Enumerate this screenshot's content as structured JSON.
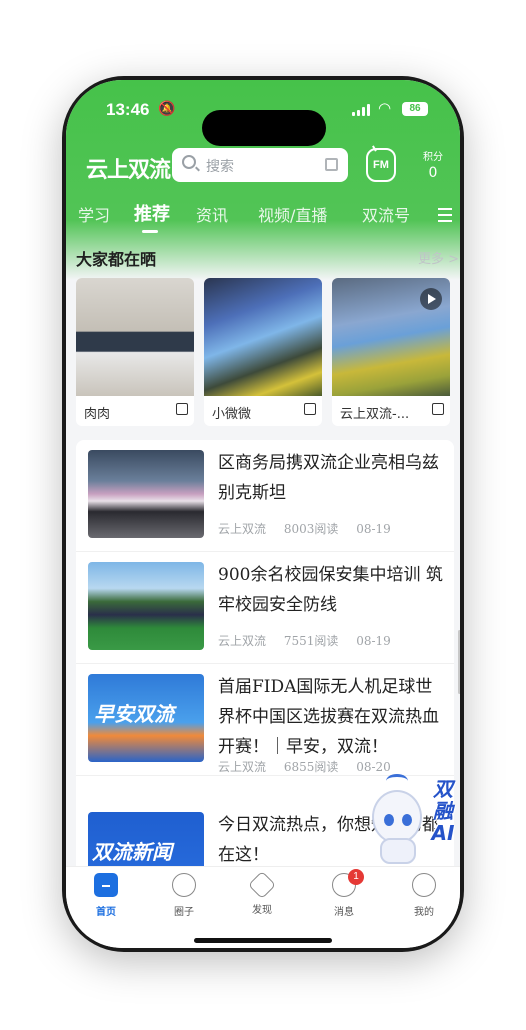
{
  "status": {
    "time": "13:46",
    "battery": "86"
  },
  "header": {
    "logo": "云上双流",
    "search_placeholder": "搜索",
    "fm_label": "FM",
    "points_label": "积分",
    "points_value": "0"
  },
  "tabs": [
    {
      "label": "学习"
    },
    {
      "label": "推荐"
    },
    {
      "label": "资讯"
    },
    {
      "label": "视频/直播"
    },
    {
      "label": "双流号"
    }
  ],
  "section": {
    "title": "大家都在晒",
    "more": "更多 >"
  },
  "cards": [
    {
      "caption": "肉肉"
    },
    {
      "caption": "小微微"
    },
    {
      "caption": "云上双流-..."
    }
  ],
  "news": [
    {
      "title": "区商务局携双流企业亮相乌兹别克斯坦",
      "source": "云上双流",
      "reads": "8003阅读",
      "date": "08-19"
    },
    {
      "title": "900余名校园保安集中培训 筑牢校园安全防线",
      "source": "云上双流",
      "reads": "7551阅读",
      "date": "08-19"
    },
    {
      "title": "首届FIDA国际无人机足球世界杯中国区选拔赛在双流热血开赛！｜早安，双流！",
      "source": "云上双流",
      "reads": "6855阅读",
      "date": "08-20"
    },
    {
      "title": "今日双流热点，你想知道的都在这！",
      "source": "",
      "reads": "",
      "date": ""
    }
  ],
  "news_images": {
    "img3_text": "早安双流",
    "img4_text": "双流新闻"
  },
  "ai": {
    "label_line1": "双融",
    "label_line2": "AI"
  },
  "tabbar": [
    {
      "label": "首页",
      "icon": "home-icon"
    },
    {
      "label": "圈子",
      "icon": "circle-icon"
    },
    {
      "label": "发现",
      "icon": "discover-icon"
    },
    {
      "label": "消息",
      "icon": "message-icon",
      "badge": "1"
    },
    {
      "label": "我的",
      "icon": "profile-icon"
    }
  ]
}
